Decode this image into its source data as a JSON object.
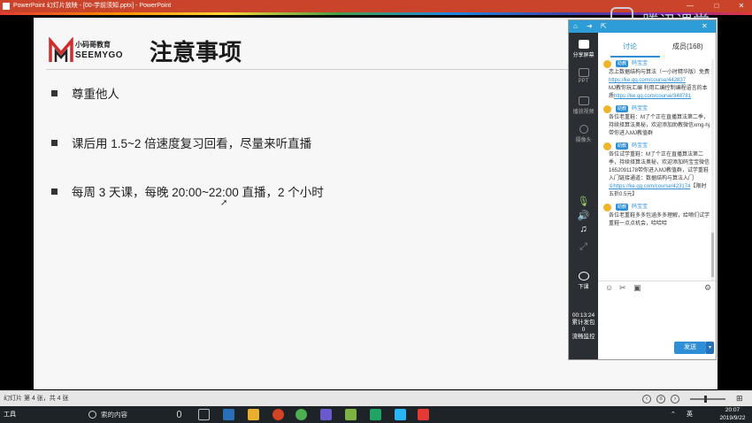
{
  "window": {
    "title": "PowerPoint 幻灯片放映 - [00-学前须知.pptx] - PowerPoint",
    "controls": [
      "—",
      "□",
      "✕"
    ]
  },
  "slide": {
    "logo_cn": "小码哥教育",
    "logo_en": "SEEMYGO",
    "title": "注意事项",
    "bullets": [
      "尊重他人",
      "课后用 1.5~2 倍速度复习回看，尽量来听直播",
      "每周 3 天课，每晚 20:00~22:00 直播，2 个小时"
    ]
  },
  "statusbar": {
    "text": "幻灯片 第 4 张，共 4 张"
  },
  "taskbar": {
    "search_placeholder": "索的内容",
    "start_label": "工具",
    "clock_time": "20:07",
    "clock_date": "2019/9/22",
    "ime": "英"
  },
  "classroom": {
    "tabs": [
      "讨论",
      "成员(168)"
    ],
    "sidebar": [
      "分享屏幕",
      "PPT",
      "播放视频",
      "摄像头"
    ],
    "end_label": "下课",
    "timer": "00:13:24",
    "stats_label": "累计发包",
    "stats_value": "0",
    "net_label": "流畅监控",
    "send_label": "发送",
    "messages": [
      {
        "badge": "助教",
        "name": "码宝宝",
        "text": "恋上数据结构与算法（一小时精华版）免费",
        "link": "https://ke.qq.com/course/442837",
        "text2": "MJ教你玩汇编 利用汇编控制编程语言的本质",
        "link2": "https://ke.qq.com/course/348781"
      },
      {
        "badge": "助教",
        "name": "码宝宝",
        "text": "各位老重鞋：M了个正在直播算法第二季，持续择算法奥秘，欢迎添加助教微信xmg-hj带你进入MJ教值群"
      },
      {
        "badge": "助教",
        "name": "码宝宝",
        "text": "各位试学重鞋：M了个正在直播算法第二季，持续择算法奥秘，欢迎添加码宝宝微信1652091178带你进入MJ教值群，试学重鞋入门链接通道：数据结构与算法入门",
        "link": "①https://ke.qq.com/course/423174",
        "text2": "【限时五折0.5元】"
      },
      {
        "badge": "助教",
        "name": "码宝宝",
        "text": "各位老重鞋多多包涵多多理解，给嘀们试学重鞋一点点机会，哈哈哈"
      }
    ]
  },
  "watermark": "腾讯课堂",
  "colors": {
    "titlebar": "#c9442b",
    "accent": "#2e8fd6",
    "slide_bg": "#f7f7f7"
  }
}
